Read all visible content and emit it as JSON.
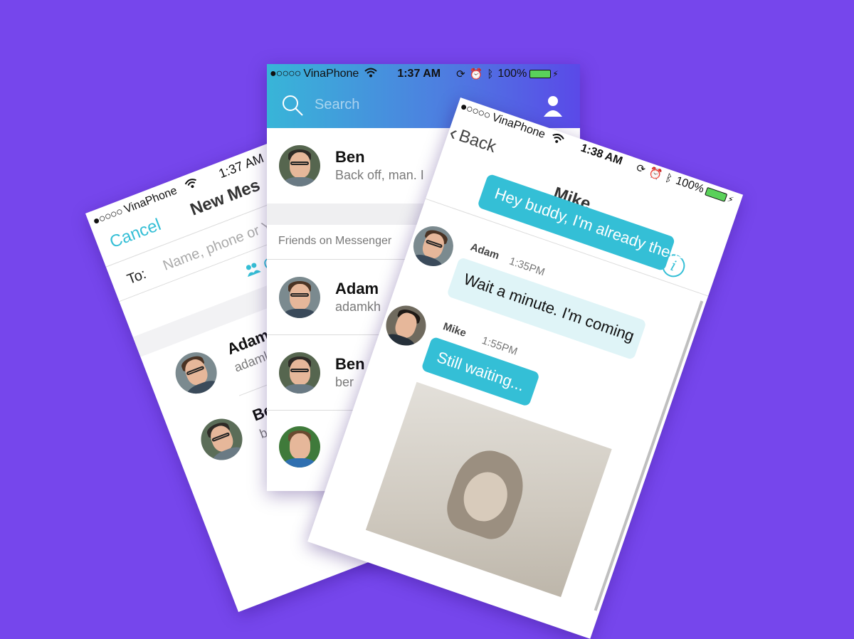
{
  "colors": {
    "background": "#7646ec",
    "accent": "#35bfd6",
    "header_gradient_start": "#38b5d8",
    "header_gradient_end": "#5a49e8"
  },
  "new_message_screen": {
    "status": {
      "signal": "●○○○○",
      "carrier": "VinaPhone",
      "time": "1:37 AM"
    },
    "cancel_label": "Cancel",
    "title": "New Mes",
    "to_label": "To:",
    "to_placeholder": "Name, phone or Ya",
    "create_group_label": "Cre",
    "contacts": [
      {
        "name": "Adam",
        "handle": "adamkh"
      },
      {
        "name": "Ben",
        "handle": "ber"
      }
    ]
  },
  "contacts_screen": {
    "status": {
      "signal": "●○○○○",
      "carrier": "VinaPhone",
      "time": "1:37 AM",
      "battery": "100%"
    },
    "search_placeholder": "Search",
    "top_conversation": {
      "name": "Ben",
      "preview": "Back off, man. I"
    },
    "section_label": "Friends on Messenger",
    "friends": [
      {
        "name": "Adam",
        "handle": "adamkh"
      },
      {
        "name": "Ben",
        "handle": "ber"
      },
      {
        "name": "",
        "handle": ""
      }
    ]
  },
  "chat_screen": {
    "status": {
      "signal": "●○○○○",
      "carrier": "VinaPhone",
      "time": "1:38 AM",
      "battery": "100%"
    },
    "back_label": "Back",
    "title": "Mike",
    "info_icon_glyph": "i",
    "messages": [
      {
        "sender": "",
        "time": "",
        "text": "Hey buddy, I'm already there",
        "style": "outgoing"
      },
      {
        "sender": "Adam",
        "time": "1:35PM",
        "text": "Wait a minute. I'm coming",
        "style": "incoming"
      },
      {
        "sender": "Mike",
        "time": "1:55PM",
        "text": "Still waiting...",
        "style": "highlight"
      }
    ]
  }
}
